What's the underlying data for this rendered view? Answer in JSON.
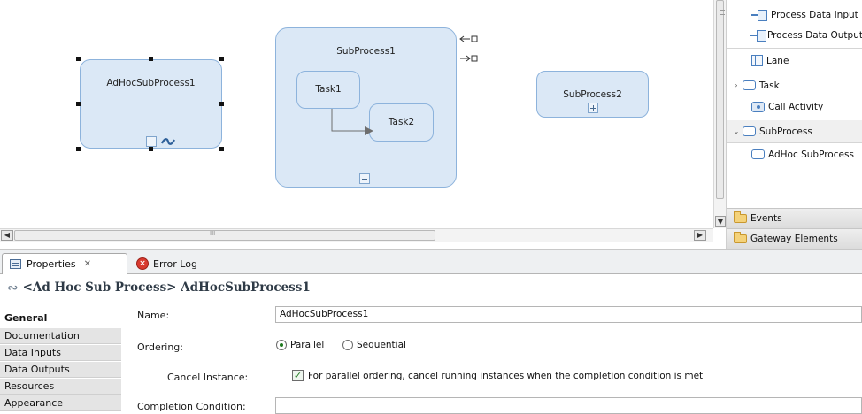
{
  "diagram": {
    "adhoc_subprocess": {
      "label": "AdHocSubProcess1"
    },
    "subprocess1": {
      "label": "SubProcess1",
      "task1": "Task1",
      "task2": "Task2"
    },
    "subprocess2": {
      "label": "SubProcess2"
    }
  },
  "palette": {
    "items": [
      {
        "label": "Process Data Input",
        "icon": "data-input-icon"
      },
      {
        "label": "Process Data Output",
        "icon": "data-output-icon"
      },
      {
        "label": "Lane",
        "icon": "lane-icon"
      },
      {
        "label": "Task",
        "icon": "task-icon",
        "expandable": true
      },
      {
        "label": "Call Activity",
        "icon": "call-activity-icon"
      },
      {
        "label": "SubProcess",
        "icon": "subprocess-icon",
        "expanded": true
      },
      {
        "label": "AdHoc SubProcess",
        "icon": "adhoc-subprocess-icon"
      }
    ],
    "drawers": [
      {
        "label": "Events",
        "icon": "folder-icon"
      },
      {
        "label": "Gateway Elements",
        "icon": "folder-icon"
      }
    ]
  },
  "bottom_tabs": [
    {
      "label": "Properties",
      "close": "✕",
      "active": true,
      "icon": "properties-icon"
    },
    {
      "label": "Error Log",
      "active": false,
      "icon": "error-log-icon"
    }
  ],
  "properties": {
    "header": "<Ad Hoc Sub Process> AdHocSubProcess1",
    "sections": [
      "General",
      "Documentation",
      "Data Inputs",
      "Data Outputs",
      "Resources",
      "Appearance"
    ],
    "active_section": "General",
    "fields": {
      "name_label": "Name:",
      "name_value": "AdHocSubProcess1",
      "ordering_label": "Ordering:",
      "ordering_options": [
        "Parallel",
        "Sequential"
      ],
      "ordering_selected": "Parallel",
      "cancel_label": "Cancel Instance:",
      "cancel_text": "For parallel ordering, cancel running instances when the completion condition is met",
      "cancel_checked": true,
      "completion_label": "Completion Condition:",
      "completion_value": ""
    }
  },
  "scrollbars": {
    "h_thumb_grip": "III"
  },
  "colors": {
    "node_fill": "#dbe8f6",
    "node_border": "#8db3dc",
    "selection_handle": "#111111"
  }
}
